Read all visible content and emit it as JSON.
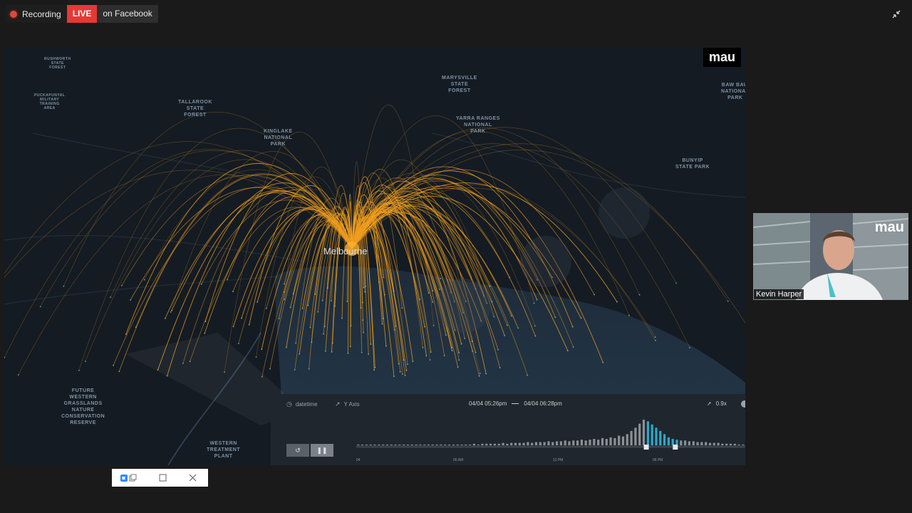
{
  "status": {
    "recording_label": "Recording",
    "live_label": "LIVE",
    "live_target": "on Facebook"
  },
  "share": {
    "brand": "mau",
    "city": "Melbourne",
    "map_labels": [
      {
        "id": "rushworth",
        "text": "RUSHWORTH\nSTATE\nFOREST"
      },
      {
        "id": "puckapunyal",
        "text": "PUCKAPUNYAL\nMILITARY\nTRAINING\nAREA"
      },
      {
        "id": "tallarook",
        "text": "TALLAROOK\nSTATE\nFOREST"
      },
      {
        "id": "kinglake",
        "text": "KINGLAKE\nNATIONAL\nPARK"
      },
      {
        "id": "marysville",
        "text": "MARYSVILLE\nSTATE\nFOREST"
      },
      {
        "id": "yarra",
        "text": "YARRA RANGES\nNATIONAL\nPARK"
      },
      {
        "id": "bawbaw",
        "text": "BAW BAW\nNATIONAL\nPARK"
      },
      {
        "id": "bunyip",
        "text": "BUNYIP\nSTATE PARK"
      },
      {
        "id": "grasslands",
        "text": "FUTURE\nWESTERN\nGRASSLANDS\nNATURE\nCONSERVATION\nRESERVE"
      },
      {
        "id": "treatment",
        "text": "WESTERN\nTREATMENT\nPLANT"
      }
    ]
  },
  "timeline": {
    "datetime_label": "datetime",
    "yaxis_label": "Y Axis",
    "range_start": "04/04 05:26pm",
    "range_end": "04/04 06:28pm",
    "speed": "0.9x",
    "rewind_icon": "rewind-icon",
    "pause_icon": "pause-icon",
    "ticks": [
      "04",
      "06 AM",
      "12 PM",
      "06 PM"
    ],
    "histogram": [
      1,
      1,
      1,
      1,
      1,
      1,
      1,
      1,
      1,
      1,
      1,
      1,
      1,
      1,
      1,
      1,
      1,
      1,
      1,
      1,
      1,
      1,
      1,
      1,
      1,
      1,
      1,
      1,
      2,
      1,
      2,
      2,
      2,
      2,
      2,
      3,
      2,
      3,
      3,
      3,
      3,
      4,
      3,
      4,
      4,
      4,
      5,
      4,
      5,
      5,
      6,
      5,
      6,
      6,
      7,
      6,
      7,
      8,
      7,
      9,
      8,
      10,
      9,
      12,
      11,
      14,
      18,
      22,
      27,
      32,
      30,
      26,
      22,
      18,
      14,
      10,
      8,
      7,
      6,
      6,
      5,
      5,
      4,
      4,
      4,
      3,
      3,
      3,
      2,
      2,
      2,
      2,
      1,
      1
    ],
    "highlight_range": [
      70,
      77
    ],
    "accent_color": "#2fa7c6",
    "bar_color": "#8a9096"
  },
  "video": {
    "brand": "mau",
    "participant_name": "Kevin Harper"
  }
}
